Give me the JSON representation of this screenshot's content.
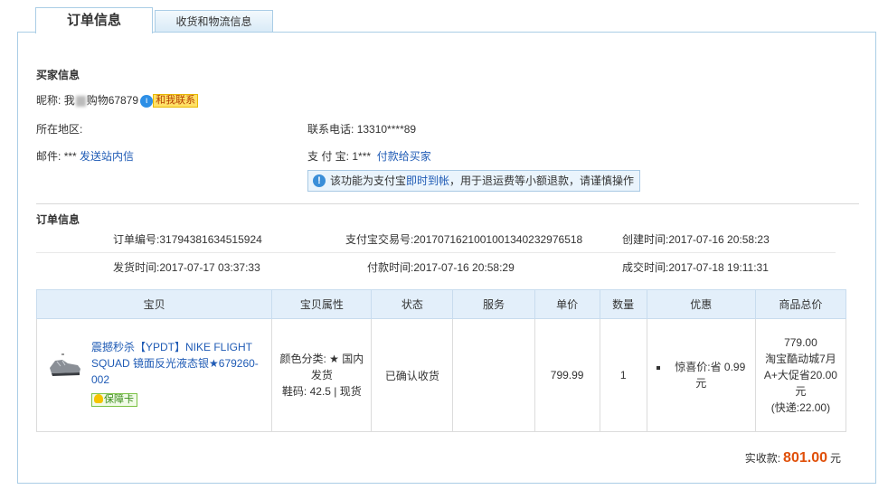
{
  "tabs": [
    {
      "label": "订单信息"
    },
    {
      "label": "收货和物流信息"
    }
  ],
  "buyer": {
    "section_title": "买家信息",
    "nickname_label": "昵称:",
    "nickname_prefix": "我",
    "nickname_suffix": "购物67879",
    "contact_badge": "和我联系",
    "region_label": "所在地区:",
    "region_value": "",
    "phone_label": "联系电话:",
    "phone_value": "13310****89",
    "email_label": "邮件:",
    "email_value": "***",
    "email_link": "发送站内信",
    "alipay_label": "支 付 宝:",
    "alipay_value": "1***",
    "alipay_link": "付款给买家",
    "notice_prefix": "该功能为支付宝",
    "notice_link": "即时到帐",
    "notice_suffix": "，用于退运费等小额退款，请谨慎操作"
  },
  "order": {
    "section_title": "订单信息",
    "order_no_label": "订单编号:",
    "order_no": "31794381634515924",
    "alipay_no_label": "支付宝交易号:",
    "alipay_no": "2017071621001001340232976518",
    "created_label": "创建时间:",
    "created": "2017-07-16 20:58:23",
    "shipped_label": "发货时间:",
    "shipped": "2017-07-17 03:37:33",
    "paid_label": "付款时间:",
    "paid": "2017-07-16 20:58:29",
    "completed_label": "成交时间:",
    "completed": "2017-07-18 19:11:31"
  },
  "table": {
    "headers": [
      "宝贝",
      "宝贝属性",
      "状态",
      "服务",
      "单价",
      "数量",
      "优惠",
      "商品总价"
    ],
    "row": {
      "title": "震撼秒杀【YPDT】NIKE FLIGHT SQUAD 镜面反光液态银★679260-002",
      "guarantee": "保障卡",
      "attr_color": "颜色分类: ★ 国内发货",
      "attr_size": "鞋码: 42.5 | 现货",
      "status": "已确认收货",
      "service": "",
      "price": "799.99",
      "qty": "1",
      "promo": "惊喜价:省 0.99 元",
      "total_amount": "779.00",
      "total_note": "淘宝酷动城7月A+大促省20.00元",
      "total_shipping": "(快递:22.00)"
    }
  },
  "payment": {
    "label": "实收款:",
    "amount": "801.00",
    "unit": "元"
  },
  "colors": {
    "link": "#1f5bb5",
    "accent_orange": "#e0500a",
    "header_bg": "#e3effa",
    "border_blue": "#aacde6"
  }
}
